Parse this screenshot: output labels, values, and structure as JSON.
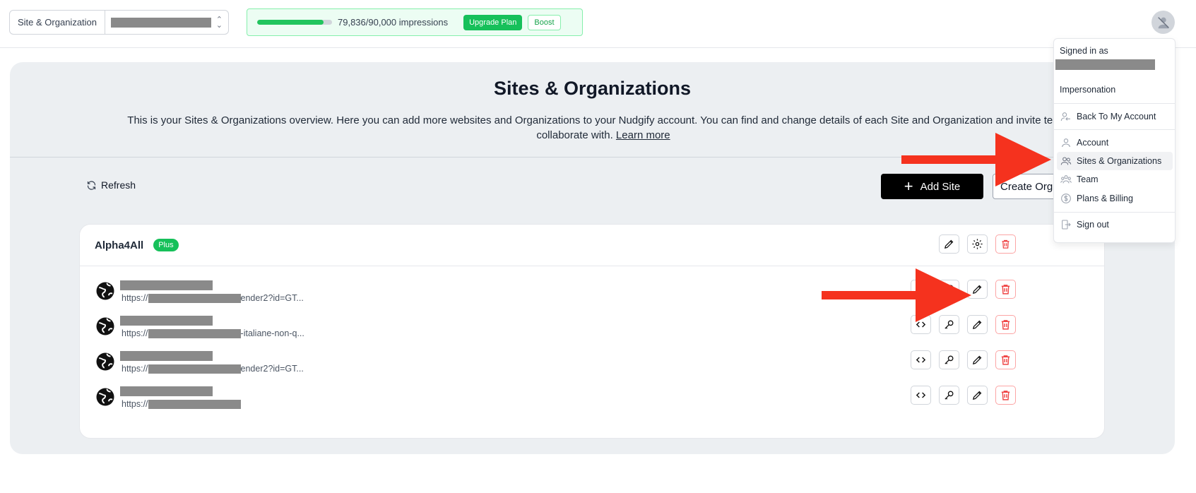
{
  "topbar": {
    "site_label": "Site & Organization",
    "usage_text": "79,836/90,000 impressions",
    "usage_fraction": 0.887,
    "upgrade_label": "Upgrade Plan",
    "boost_label": "Boost"
  },
  "main": {
    "title": "Sites & Organizations",
    "description": "This is your Sites & Organizations overview. Here you can add more websites and Organizations to your Nudgify account. You can find and change details of each Site and Organization and invite team m",
    "description_line2": "collaborate with.",
    "learn_more": "Learn more",
    "refresh_label": "Refresh",
    "add_site_label": "Add Site",
    "create_org_label": "Create Org"
  },
  "organization": {
    "name": "Alpha4All",
    "plan_badge": "Plus",
    "sites": [
      {
        "url_prefix": "https://",
        "url_suffix": "ender2?id=GT..."
      },
      {
        "url_prefix": "https://",
        "url_suffix": "-italiane-non-q..."
      },
      {
        "url_prefix": "https://",
        "url_suffix": "ender2?id=GT..."
      },
      {
        "url_prefix": "https://",
        "url_suffix": ""
      }
    ]
  },
  "menu": {
    "signed_in_label": "Signed in as",
    "impersonation_label": "Impersonation",
    "items": [
      {
        "label": "Back To My Account",
        "icon": "user-back-icon"
      },
      {
        "label": "Account",
        "icon": "user-icon"
      },
      {
        "label": "Sites & Organizations",
        "icon": "users-icon",
        "active": true
      },
      {
        "label": "Team",
        "icon": "team-icon"
      },
      {
        "label": "Plans & Billing",
        "icon": "dollar-circle-icon"
      },
      {
        "label": "Sign out",
        "icon": "sign-out-icon"
      }
    ]
  },
  "colors": {
    "accent_green": "#16c05a",
    "annotation_red": "#f5321e",
    "danger": "#ef4444"
  }
}
